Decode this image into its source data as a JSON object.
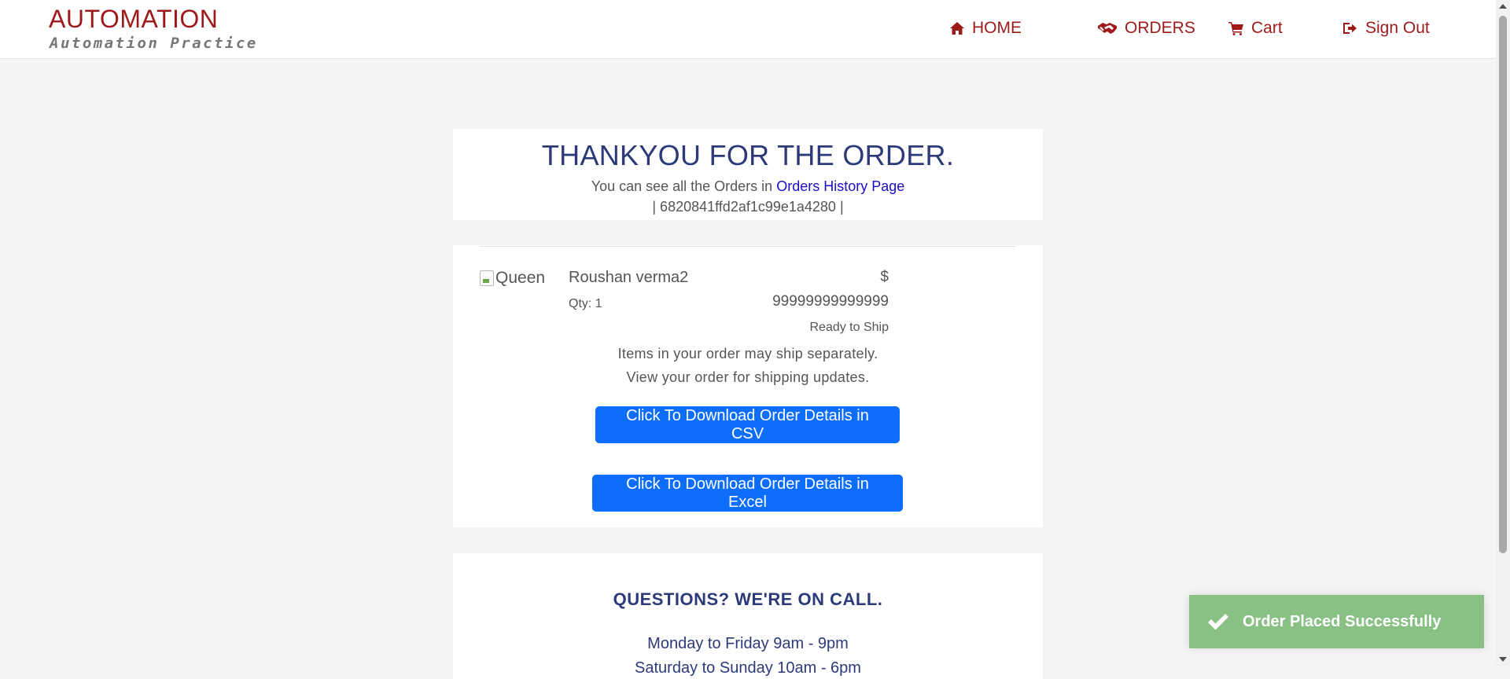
{
  "header": {
    "brand_title": "AUTOMATION",
    "brand_subtitle": "Automation Practice",
    "nav": {
      "home": "HOME",
      "orders": "ORDERS",
      "cart": "Cart",
      "signout": "Sign Out"
    }
  },
  "confirmation": {
    "title": "THANKYOU FOR THE ORDER.",
    "history_prefix": "You can see all the Orders in",
    "history_link": "Orders History Page",
    "order_id_line": "| 6820841ffd2af1c99e1a4280 |"
  },
  "order_item": {
    "image_alt": "Queen",
    "name": "Roushan verma2",
    "qty": "Qty: 1",
    "currency": "$",
    "price": "99999999999999",
    "status": "Ready to Ship",
    "note_line1": "Items in your order may ship separately.",
    "note_line2": "View your order for shipping updates.",
    "csv_button": "Click To Download Order Details in CSV",
    "excel_button": "Click To Download Order Details in Excel"
  },
  "support": {
    "title": "QUESTIONS? WE'RE ON CALL.",
    "hours_weekday": "Monday to Friday 9am - 9pm",
    "hours_weekend": "Saturday to Sunday 10am - 6pm"
  },
  "toast": {
    "message": "Order Placed Successfully"
  },
  "colors": {
    "brand": "#9e1a1a",
    "heading": "#2c3a7a",
    "primary_button": "#0d6efd",
    "toast_bg": "#89c185",
    "link": "#1a0dcc"
  }
}
